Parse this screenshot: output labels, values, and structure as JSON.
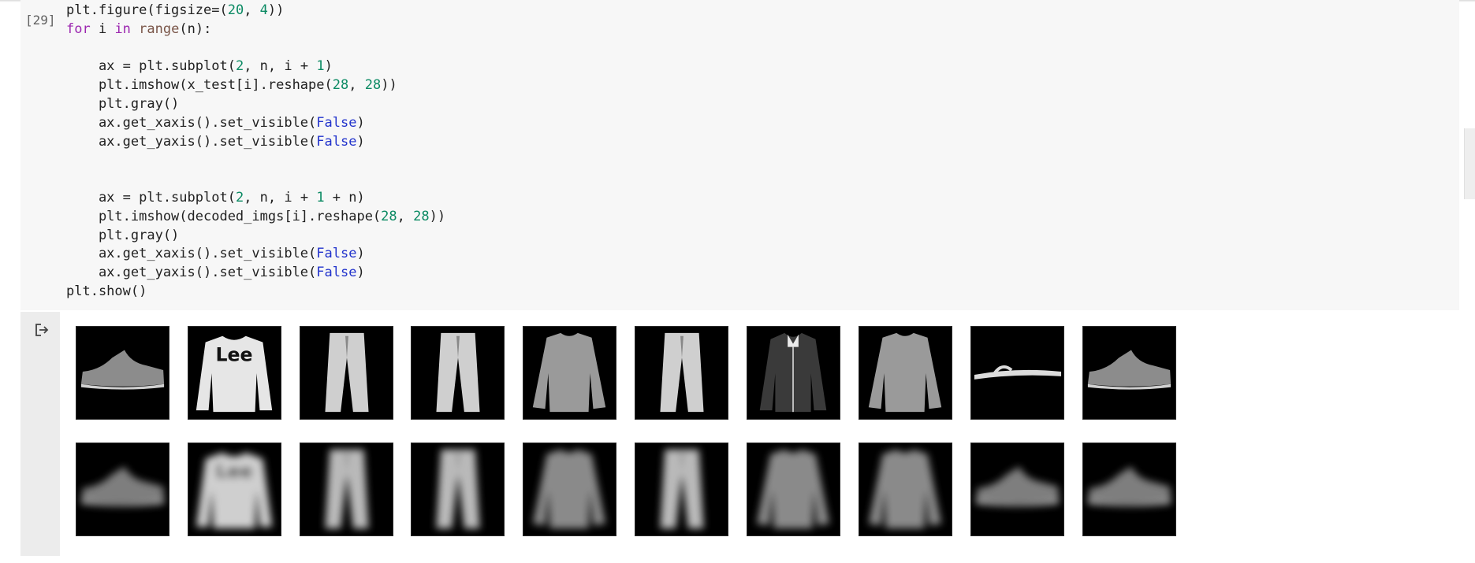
{
  "cell": {
    "execution_count": "[29]",
    "code_lines": [
      [
        [
          "plt.figure(figsize=(",
          ""
        ],
        [
          "20",
          "num"
        ],
        [
          ", ",
          ""
        ],
        [
          "4",
          "num"
        ],
        [
          "))",
          ""
        ]
      ],
      [
        [
          "for",
          "kw"
        ],
        [
          " i ",
          ""
        ],
        [
          "in",
          "kw"
        ],
        [
          " ",
          ""
        ],
        [
          "range",
          "fn"
        ],
        [
          "(n):",
          ""
        ]
      ],
      [],
      [
        [
          "    ax = plt.subplot(",
          ""
        ],
        [
          "2",
          "num"
        ],
        [
          ", n, i + ",
          ""
        ],
        [
          "1",
          "num"
        ],
        [
          ")",
          ""
        ]
      ],
      [
        [
          "    plt.imshow(x_test[i].reshape(",
          ""
        ],
        [
          "28",
          "num"
        ],
        [
          ", ",
          ""
        ],
        [
          "28",
          "num"
        ],
        [
          "))",
          ""
        ]
      ],
      [
        [
          "    plt.gray()",
          ""
        ]
      ],
      [
        [
          "    ax.get_xaxis().set_visible(",
          ""
        ],
        [
          "False",
          "bool"
        ],
        [
          ")",
          ""
        ]
      ],
      [
        [
          "    ax.get_yaxis().set_visible(",
          ""
        ],
        [
          "False",
          "bool"
        ],
        [
          ")",
          ""
        ]
      ],
      [],
      [],
      [
        [
          "    ax = plt.subplot(",
          ""
        ],
        [
          "2",
          "num"
        ],
        [
          ", n, i + ",
          ""
        ],
        [
          "1",
          "num"
        ],
        [
          " + n)",
          ""
        ]
      ],
      [
        [
          "    plt.imshow(decoded_imgs[i].reshape(",
          ""
        ],
        [
          "28",
          "num"
        ],
        [
          ", ",
          ""
        ],
        [
          "28",
          "num"
        ],
        [
          "))",
          ""
        ]
      ],
      [
        [
          "    plt.gray()",
          ""
        ]
      ],
      [
        [
          "    ax.get_xaxis().set_visible(",
          ""
        ],
        [
          "False",
          "bool"
        ],
        [
          ")",
          ""
        ]
      ],
      [
        [
          "    ax.get_yaxis().set_visible(",
          ""
        ],
        [
          "False",
          "bool"
        ],
        [
          ")",
          ""
        ]
      ],
      [
        [
          "plt.show()",
          ""
        ]
      ]
    ]
  },
  "output": {
    "icon": "output-redirect-icon",
    "originals": [
      "sneaker",
      "sweater",
      "trousers",
      "trousers",
      "shirt",
      "trousers",
      "coat",
      "shirt",
      "sandal",
      "sneaker"
    ],
    "decoded": [
      "sneaker",
      "sweater",
      "trousers",
      "trousers",
      "shirt",
      "trousers",
      "shirt",
      "shirt",
      "sneaker",
      "sneaker"
    ]
  }
}
